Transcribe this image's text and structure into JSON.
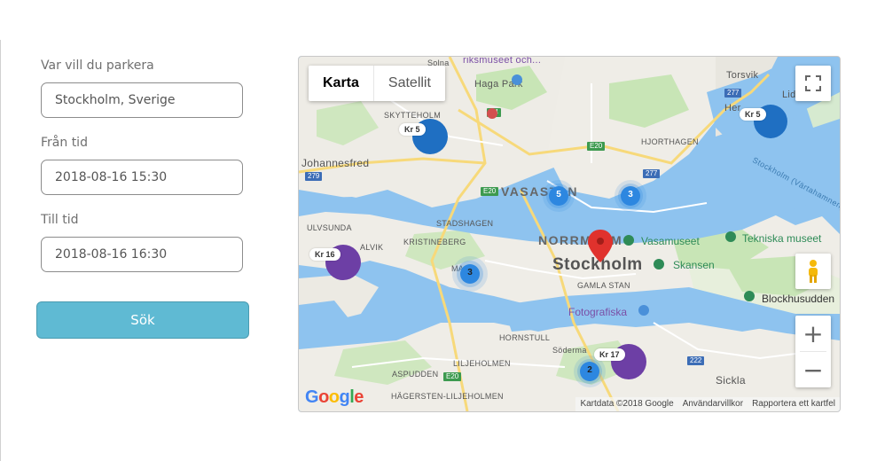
{
  "form": {
    "location_label": "Var vill du parkera",
    "location_value": "Stockholm, Sverige",
    "from_label": "Från tid",
    "from_value": "2018-08-16 15:30",
    "to_label": "Till tid",
    "to_value": "2018-08-16 16:30",
    "search_button": "Sök"
  },
  "map": {
    "type_map": "Karta",
    "type_satellite": "Satellit",
    "attribution": {
      "mapdata": "Kartdata ©2018 Google",
      "terms": "Användarvillkor",
      "report": "Rapportera ett kartfel"
    },
    "logo": "Google",
    "labels": {
      "solna": "Solna",
      "museum": "riksmuseet och...",
      "hagapark": "Haga Park",
      "torsvik": "Torsvik",
      "lidingo": "Lid",
      "herserud": "Her",
      "skytteholm": "SKYTTEHOLM",
      "johannesfred": "Johannesfred",
      "hjorthagen": "HJORTHAGEN",
      "vasastan": "VASASTAN",
      "stadshagen": "STADSHAGEN",
      "ulvsunda": "ULVSUNDA",
      "alvik": "ALVIK",
      "kristineberg": "KRISTINEBERG",
      "marieberg": "MA",
      "norrmalm": "NORRMALM",
      "stockholm": "Stockholm",
      "gamlastan": "GAMLA STAN",
      "vasamuseet": "Vasamuseet",
      "tekniska": "Tekniska museet",
      "skansen": "Skansen",
      "blockhus": "Blockhusudden",
      "fotografiska": "Fotografiska",
      "hornstull": "HORNSTULL",
      "liljeholmen": "LILJEHOLMEN",
      "aspudden": "ASPUDDEN",
      "hagersten": "HÄGERSTEN-LILJEHOLMEN",
      "sodermalm": "Söderma",
      "sickla": "Sickla",
      "strait": "Stockholm (Värtahamnen) –"
    },
    "shields": {
      "e4": "E4",
      "e20a": "E20",
      "e20b": "E20",
      "e20c": "E20",
      "r277a": "277",
      "r277b": "277",
      "r279": "279",
      "r222": "222"
    },
    "price_markers": {
      "skytteholm": "Kr 5",
      "torsvik": "Kr 5",
      "alvik": "Kr 16",
      "sodermalm": "Kr 17"
    },
    "clusters": {
      "vasastan": "5",
      "hjorthagen": "3",
      "kungsholmen": "3",
      "sodermalm": "2"
    }
  }
}
